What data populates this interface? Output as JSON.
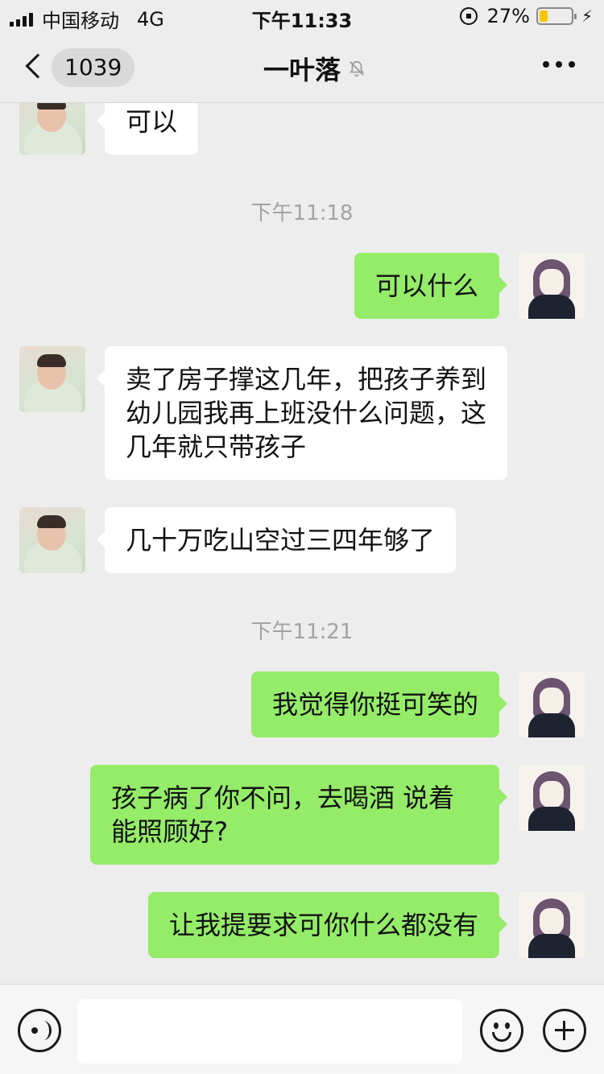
{
  "status_bar": {
    "carrier": "中国移动",
    "network": "4G",
    "time": "下午11:33",
    "battery_percent": "27%",
    "battery_level": 0.27
  },
  "nav": {
    "unread_count": "1039",
    "title": "一叶落",
    "icons": [
      "back-icon",
      "mute-bell-icon",
      "more-icon"
    ]
  },
  "messages": [
    {
      "side": "in",
      "text": "可以"
    },
    {
      "type": "time",
      "text": "下午11:18"
    },
    {
      "side": "out",
      "text": "可以什么"
    },
    {
      "side": "in",
      "text": "卖了房子撑这几年，把孩子养到幼儿园我再上班没什么问题，这几年就只带孩子"
    },
    {
      "side": "in",
      "text": "几十万吃山空过三四年够了"
    },
    {
      "type": "time",
      "text": "下午11:21"
    },
    {
      "side": "out",
      "text": "我觉得你挺可笑的"
    },
    {
      "side": "out",
      "text": "孩子病了你不问，去喝酒 说着能照顾好?"
    },
    {
      "side": "out",
      "text": "让我提要求可你什么都没有"
    }
  ],
  "input_bar": {
    "placeholder": "",
    "icons": [
      "voice-icon",
      "emoji-icon",
      "plus-icon"
    ]
  },
  "colors": {
    "outgoing_bubble": "#95ec69",
    "incoming_bubble": "#ffffff",
    "background": "#ededed",
    "battery": "#f7c600"
  }
}
